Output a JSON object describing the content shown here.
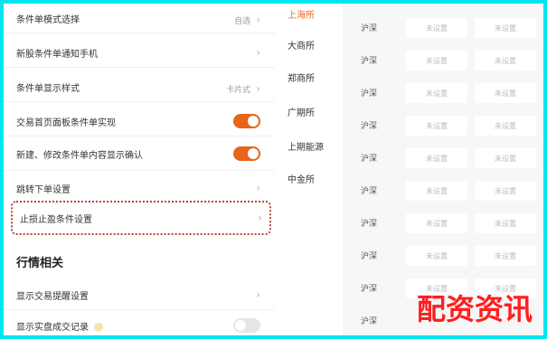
{
  "settings": [
    {
      "label": "条件单模式选择",
      "value": "自选",
      "type": "chevron"
    },
    {
      "label": "新股条件单通知手机",
      "value": "",
      "type": "chevron"
    },
    {
      "label": "条件单显示样式",
      "value": "卡片式",
      "type": "chevron"
    },
    {
      "label": "交易首页面板条件单实现",
      "value": "",
      "type": "toggle-on"
    },
    {
      "label": "新建、修改条件单内容显示确认",
      "value": "",
      "type": "toggle-on"
    },
    {
      "label": "跳转下单设置",
      "value": "",
      "type": "chevron"
    },
    {
      "label": "止损止盈条件设置",
      "value": "",
      "type": "chevron-selected"
    }
  ],
  "section": {
    "title": "行情相关"
  },
  "market": [
    {
      "label": "显示交易提醒设置",
      "value": "",
      "type": "chevron"
    },
    {
      "label": "显示实盘成交记录",
      "value": "",
      "type": "toggle-off"
    }
  ],
  "exchanges": [
    "上海所",
    "大商所",
    "郑商所",
    "广期所",
    "上期能源",
    "中金所"
  ],
  "grid": {
    "labels": [
      "沪深",
      "沪深",
      "沪深",
      "沪深",
      "沪深",
      "沪深",
      "沪深",
      "沪深",
      "沪深",
      "沪深",
      "沪深",
      "沪深"
    ],
    "cells_left": "未设置",
    "cells_right": "未设置"
  },
  "watermark": "配资资讯",
  "colors": {
    "accent": "#e8641b",
    "watermark": "#ff1f1f",
    "border": "#00e5f0"
  }
}
